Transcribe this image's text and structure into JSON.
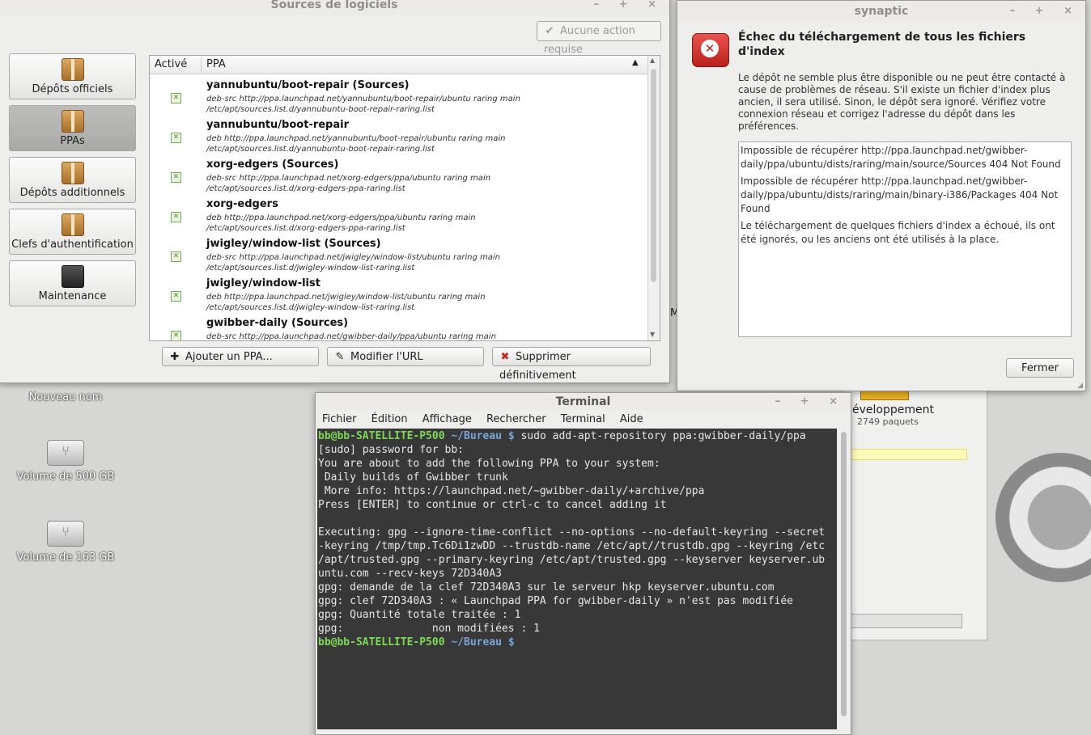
{
  "desktop": {
    "icons": [
      {
        "label": "Nouveau nom"
      },
      {
        "label": "Volume de 500 GB"
      },
      {
        "label": "Volume de 163 GB"
      }
    ]
  },
  "background_app": {
    "category_label": "éveloppement",
    "category_count": "2749 paquets",
    "partial_text": "M"
  },
  "sources": {
    "title": "Sources de logiciels",
    "status_button": "Aucune action requise",
    "sidebar": [
      {
        "label": "Dépôts officiels",
        "active": false
      },
      {
        "label": "PPAs",
        "active": true
      },
      {
        "label": "Dépôts additionnels",
        "active": false
      },
      {
        "label": "Clefs d'authentification",
        "active": false
      },
      {
        "label": "Maintenance",
        "active": false
      }
    ],
    "columns": {
      "active": "Activé",
      "ppa": "PPA"
    },
    "rows": [
      {
        "name": "yannubuntu/boot-repair (Sources)",
        "line1": "deb-src http://ppa.launchpad.net/yannubuntu/boot-repair/ubuntu raring main",
        "line2": "/etc/apt/sources.list.d/yannubuntu-boot-repair-raring.list",
        "checked": true
      },
      {
        "name": "yannubuntu/boot-repair",
        "line1": "deb http://ppa.launchpad.net/yannubuntu/boot-repair/ubuntu raring main",
        "line2": "/etc/apt/sources.list.d/yannubuntu-boot-repair-raring.list",
        "checked": true
      },
      {
        "name": "xorg-edgers (Sources)",
        "line1": "deb-src http://ppa.launchpad.net/xorg-edgers/ppa/ubuntu raring main",
        "line2": "/etc/apt/sources.list.d/xorg-edgers-ppa-raring.list",
        "checked": true
      },
      {
        "name": "xorg-edgers",
        "line1": "deb http://ppa.launchpad.net/xorg-edgers/ppa/ubuntu raring main",
        "line2": "/etc/apt/sources.list.d/xorg-edgers-ppa-raring.list",
        "checked": true
      },
      {
        "name": "jwigley/window-list (Sources)",
        "line1": "deb-src http://ppa.launchpad.net/jwigley/window-list/ubuntu raring main",
        "line2": "/etc/apt/sources.list.d/jwigley-window-list-raring.list",
        "checked": true
      },
      {
        "name": "jwigley/window-list",
        "line1": "deb http://ppa.launchpad.net/jwigley/window-list/ubuntu raring main",
        "line2": "/etc/apt/sources.list.d/jwigley-window-list-raring.list",
        "checked": true
      },
      {
        "name": "gwibber-daily (Sources)",
        "line1": "deb-src http://ppa.launchpad.net/gwibber-daily/ppa/ubuntu raring main",
        "line2": "",
        "checked": true
      }
    ],
    "buttons": {
      "add": "Ajouter un PPA...",
      "edit": "Modifier l'URL",
      "remove": "Supprimer définitivement"
    }
  },
  "synaptic": {
    "title": "synaptic",
    "heading": "Échec du téléchargement de tous les fichiers d'index",
    "description": "Le dépôt ne semble plus être disponible ou ne peut être contacté à cause de problèmes de réseau. S'il existe un fichier d'index plus ancien, il sera utilisé. Sinon, le dépôt sera ignoré. Vérifiez votre connexion réseau et corrigez l'adresse du dépôt dans les préférences.",
    "messages": [
      "Impossible de récupérer http://ppa.launchpad.net/gwibber-daily/ppa/ubuntu/dists/raring/main/source/Sources  404  Not Found",
      "Impossible de récupérer http://ppa.launchpad.net/gwibber-daily/ppa/ubuntu/dists/raring/main/binary-i386/Packages  404  Not Found",
      "Le téléchargement de quelques fichiers d'index a échoué, ils ont été ignorés, ou les anciens ont été utilisés à la place."
    ],
    "close_button": "Fermer"
  },
  "terminal": {
    "title": "Terminal",
    "menu": [
      "Fichier",
      "Édition",
      "Affichage",
      "Rechercher",
      "Terminal",
      "Aide"
    ],
    "prompt_user": "bb@bb-SATELLITE-P500",
    "prompt_path": "~/Bureau",
    "prompt_symbol": "$",
    "command": "sudo add-apt-repository ppa:gwibber-daily/ppa",
    "output": [
      "[sudo] password for bb:",
      "You are about to add the following PPA to your system:",
      " Daily builds of Gwibber trunk",
      " More info: https://launchpad.net/~gwibber-daily/+archive/ppa",
      "Press [ENTER] to continue or ctrl-c to cancel adding it",
      "",
      "Executing: gpg --ignore-time-conflict --no-options --no-default-keyring --secret",
      "-keyring /tmp/tmp.Tc6Di1zwDD --trustdb-name /etc/apt//trustdb.gpg --keyring /etc",
      "/apt/trusted.gpg --primary-keyring /etc/apt/trusted.gpg --keyserver keyserver.ub",
      "untu.com --recv-keys 72D340A3",
      "gpg: demande de la clef 72D340A3 sur le serveur hkp keyserver.ubuntu.com",
      "gpg: clef 72D340A3 : « Launchpad PPA for gwibber-daily » n'est pas modifiée",
      "gpg: Quantité totale traitée : 1",
      "gpg:              non modifiées : 1"
    ]
  }
}
